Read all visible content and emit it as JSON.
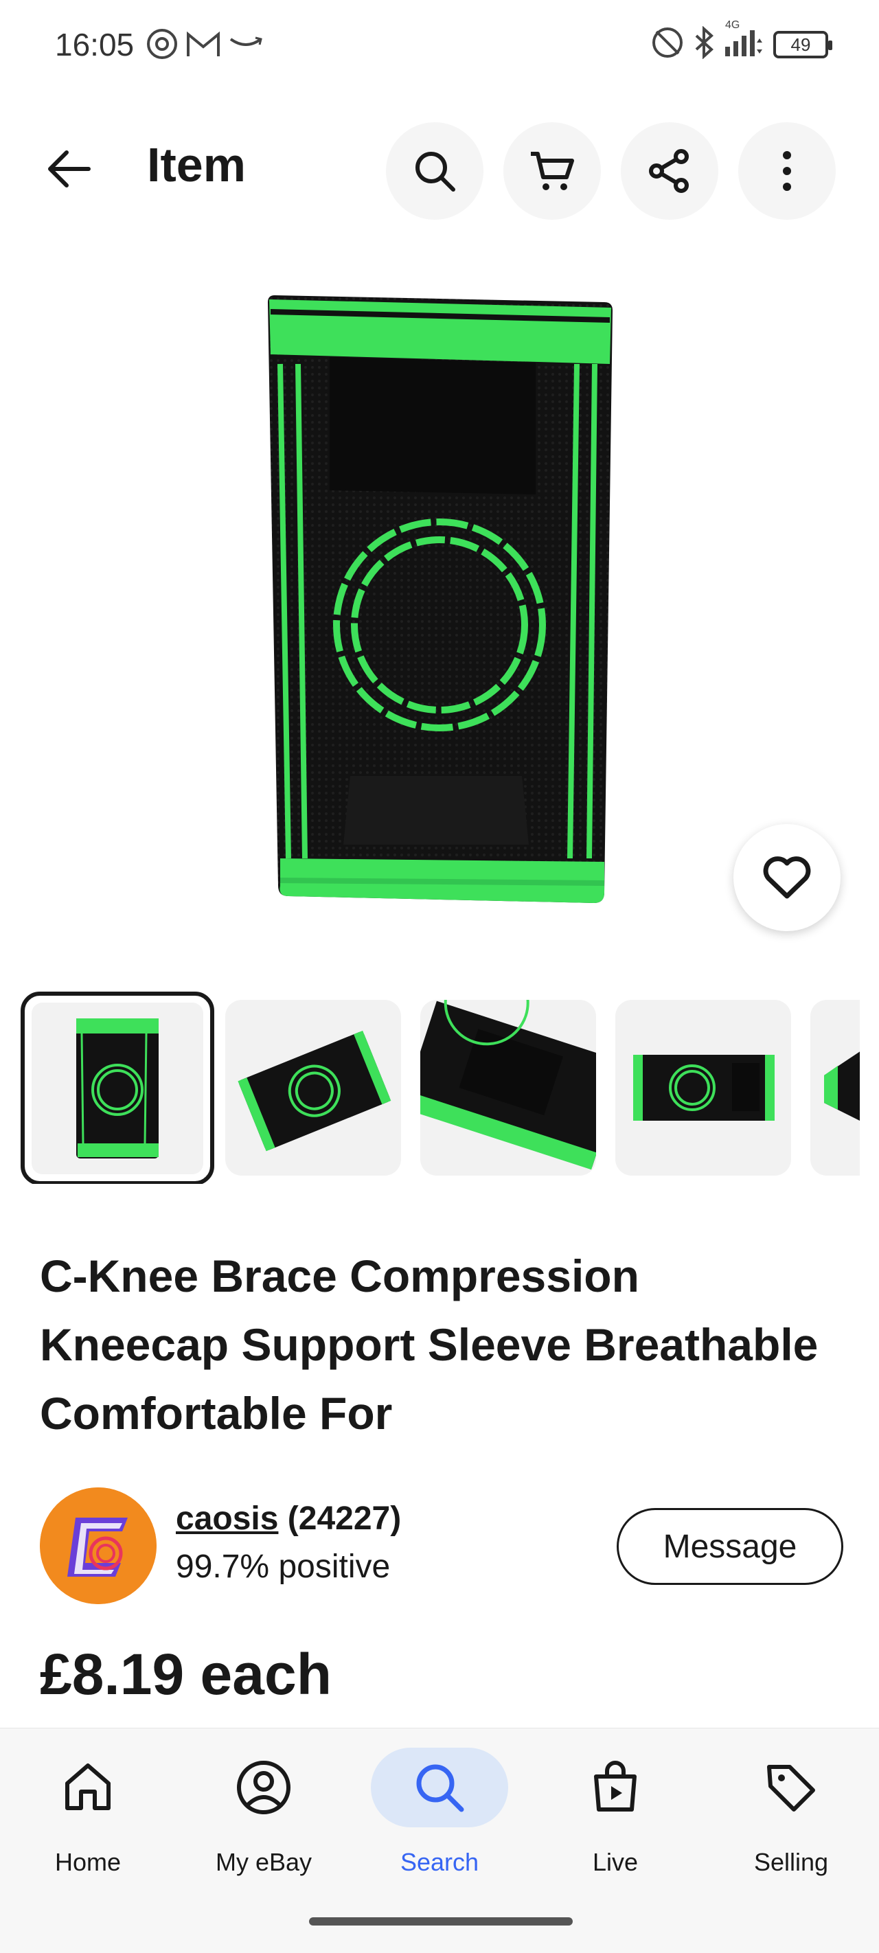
{
  "status_bar": {
    "time": "16:05",
    "network_label": "4G",
    "battery": "49",
    "icons": [
      "at-icon",
      "gmail-icon",
      "amazon-icon",
      "nfc-off-icon",
      "bluetooth-icon",
      "signal-icon"
    ]
  },
  "header": {
    "title": "Item",
    "actions": [
      "search-icon",
      "cart-icon",
      "share-icon",
      "more-vertical-icon"
    ]
  },
  "listing": {
    "title": "C-Knee Brace Compression Kneecap Support Sleeve Breathable Comfortable For",
    "price": "£8.19 each",
    "thumbnail_count_visible": 5
  },
  "seller": {
    "name": "caosis",
    "feedback_count": "(24227)",
    "positive": "99.7% positive",
    "message_label": "Message"
  },
  "bottom_nav": {
    "items": [
      {
        "label": "Home",
        "icon": "home-icon"
      },
      {
        "label": "My eBay",
        "icon": "profile-icon"
      },
      {
        "label": "Search",
        "icon": "search-icon",
        "active": true
      },
      {
        "label": "Live",
        "icon": "live-bag-icon"
      },
      {
        "label": "Selling",
        "icon": "tag-icon"
      }
    ]
  },
  "colors": {
    "accent": "#3665f3",
    "active_nav_bg": "#dce7f8",
    "product_green": "#3ee05a",
    "product_black": "#111111"
  }
}
